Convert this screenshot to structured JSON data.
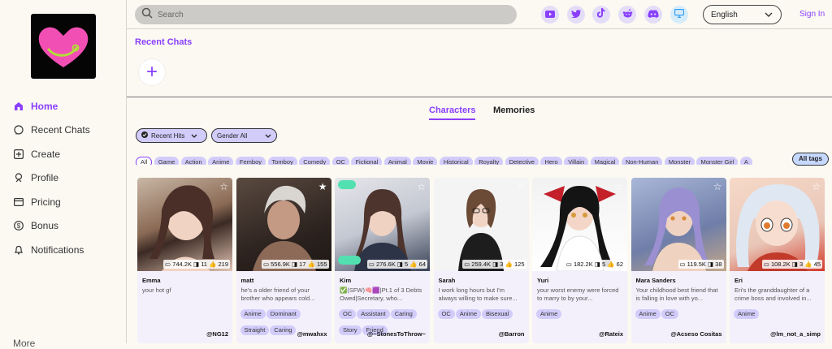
{
  "nav": {
    "items": [
      {
        "label": "Home",
        "icon": "home-icon"
      },
      {
        "label": "Recent Chats",
        "icon": "chat-icon"
      },
      {
        "label": "Create",
        "icon": "plus-square-icon"
      },
      {
        "label": "Profile",
        "icon": "profile-icon"
      },
      {
        "label": "Pricing",
        "icon": "card-icon"
      },
      {
        "label": "Bonus",
        "icon": "dollar-icon"
      },
      {
        "label": "Notifications",
        "icon": "bell-icon"
      }
    ],
    "more": "More"
  },
  "search": {
    "placeholder": "Search"
  },
  "social": [
    "youtube-icon",
    "twitter-icon",
    "tiktok-icon",
    "reddit-icon",
    "discord-icon",
    "desktop-icon"
  ],
  "language": "English",
  "signin": "Sign In",
  "recent_chats": {
    "title": "Recent Chats",
    "add": "+"
  },
  "tabs": {
    "characters": "Characters",
    "memories": "Memories"
  },
  "filters": {
    "sort": "Recent Hits",
    "gender": "Gender All"
  },
  "tags": [
    "All",
    "Game",
    "Action",
    "Anime",
    "Femboy",
    "Tomboy",
    "Comedy",
    "OC",
    "Fictional",
    "Animal",
    "Movie",
    "Historical",
    "Royalty",
    "Detective",
    "Hero",
    "Villain",
    "Magical",
    "Non-Human",
    "Monster",
    "Monster Girl",
    "A"
  ],
  "all_tags": "All tags",
  "colors": {
    "accent": "#8a3ffc",
    "tag_bg": "#d2ccfa",
    "bg": "#fbf9f2"
  },
  "cards": [
    {
      "name": "Emma",
      "stats": "▭ 744.2K ◨ 11 👍 219",
      "desc": "your hot gf",
      "tags": [],
      "author": "@NG12"
    },
    {
      "name": "matt",
      "stats": "▭ 556.9K ◨ 17 👍 155",
      "desc": "he's a older friend of your brother who appears cold...",
      "tags": [
        "Anime",
        "Dominant",
        "Straight",
        "Caring"
      ],
      "author": "@mwahxx"
    },
    {
      "name": "Kim",
      "stats": "▭ 276.6K ◨ 5 👍 64",
      "desc": "✅(SFW)🧠🟪|Pt.1 of 3 Debts Owed|Secretary, who...",
      "tags": [
        "OC",
        "Assistant",
        "Caring",
        "Story",
        "Friend"
      ],
      "author": "@~StonesToThrow~"
    },
    {
      "name": "Sarah",
      "stats": "▭ 259.4K ◨ 3 👍 125",
      "desc": "I work long hours but I'm always willing to make sure...",
      "tags": [
        "OC",
        "Anime",
        "Bisexual"
      ],
      "author": "@Barron"
    },
    {
      "name": "Yuri",
      "stats": "▭ 182.2K ◨ 5 👍 62",
      "desc": "your worst enemy were forced to marry to by your...",
      "tags": [
        "Anime"
      ],
      "author": "@Rateix"
    },
    {
      "name": "Mara Sanders",
      "stats": "▭ 119.5K ◨ 38",
      "desc": "Your childhood best friend that is falling in love with yo...",
      "tags": [
        "Anime",
        "OC"
      ],
      "author": "@Acseso Cositas"
    },
    {
      "name": "Eri",
      "stats": "▭ 108.2K ◨ 3 👍 45",
      "desc": "Eri's the granddaughter of a crime boss and involved in...",
      "tags": [
        "Anime"
      ],
      "author": "@lm_not_a_simp"
    }
  ]
}
